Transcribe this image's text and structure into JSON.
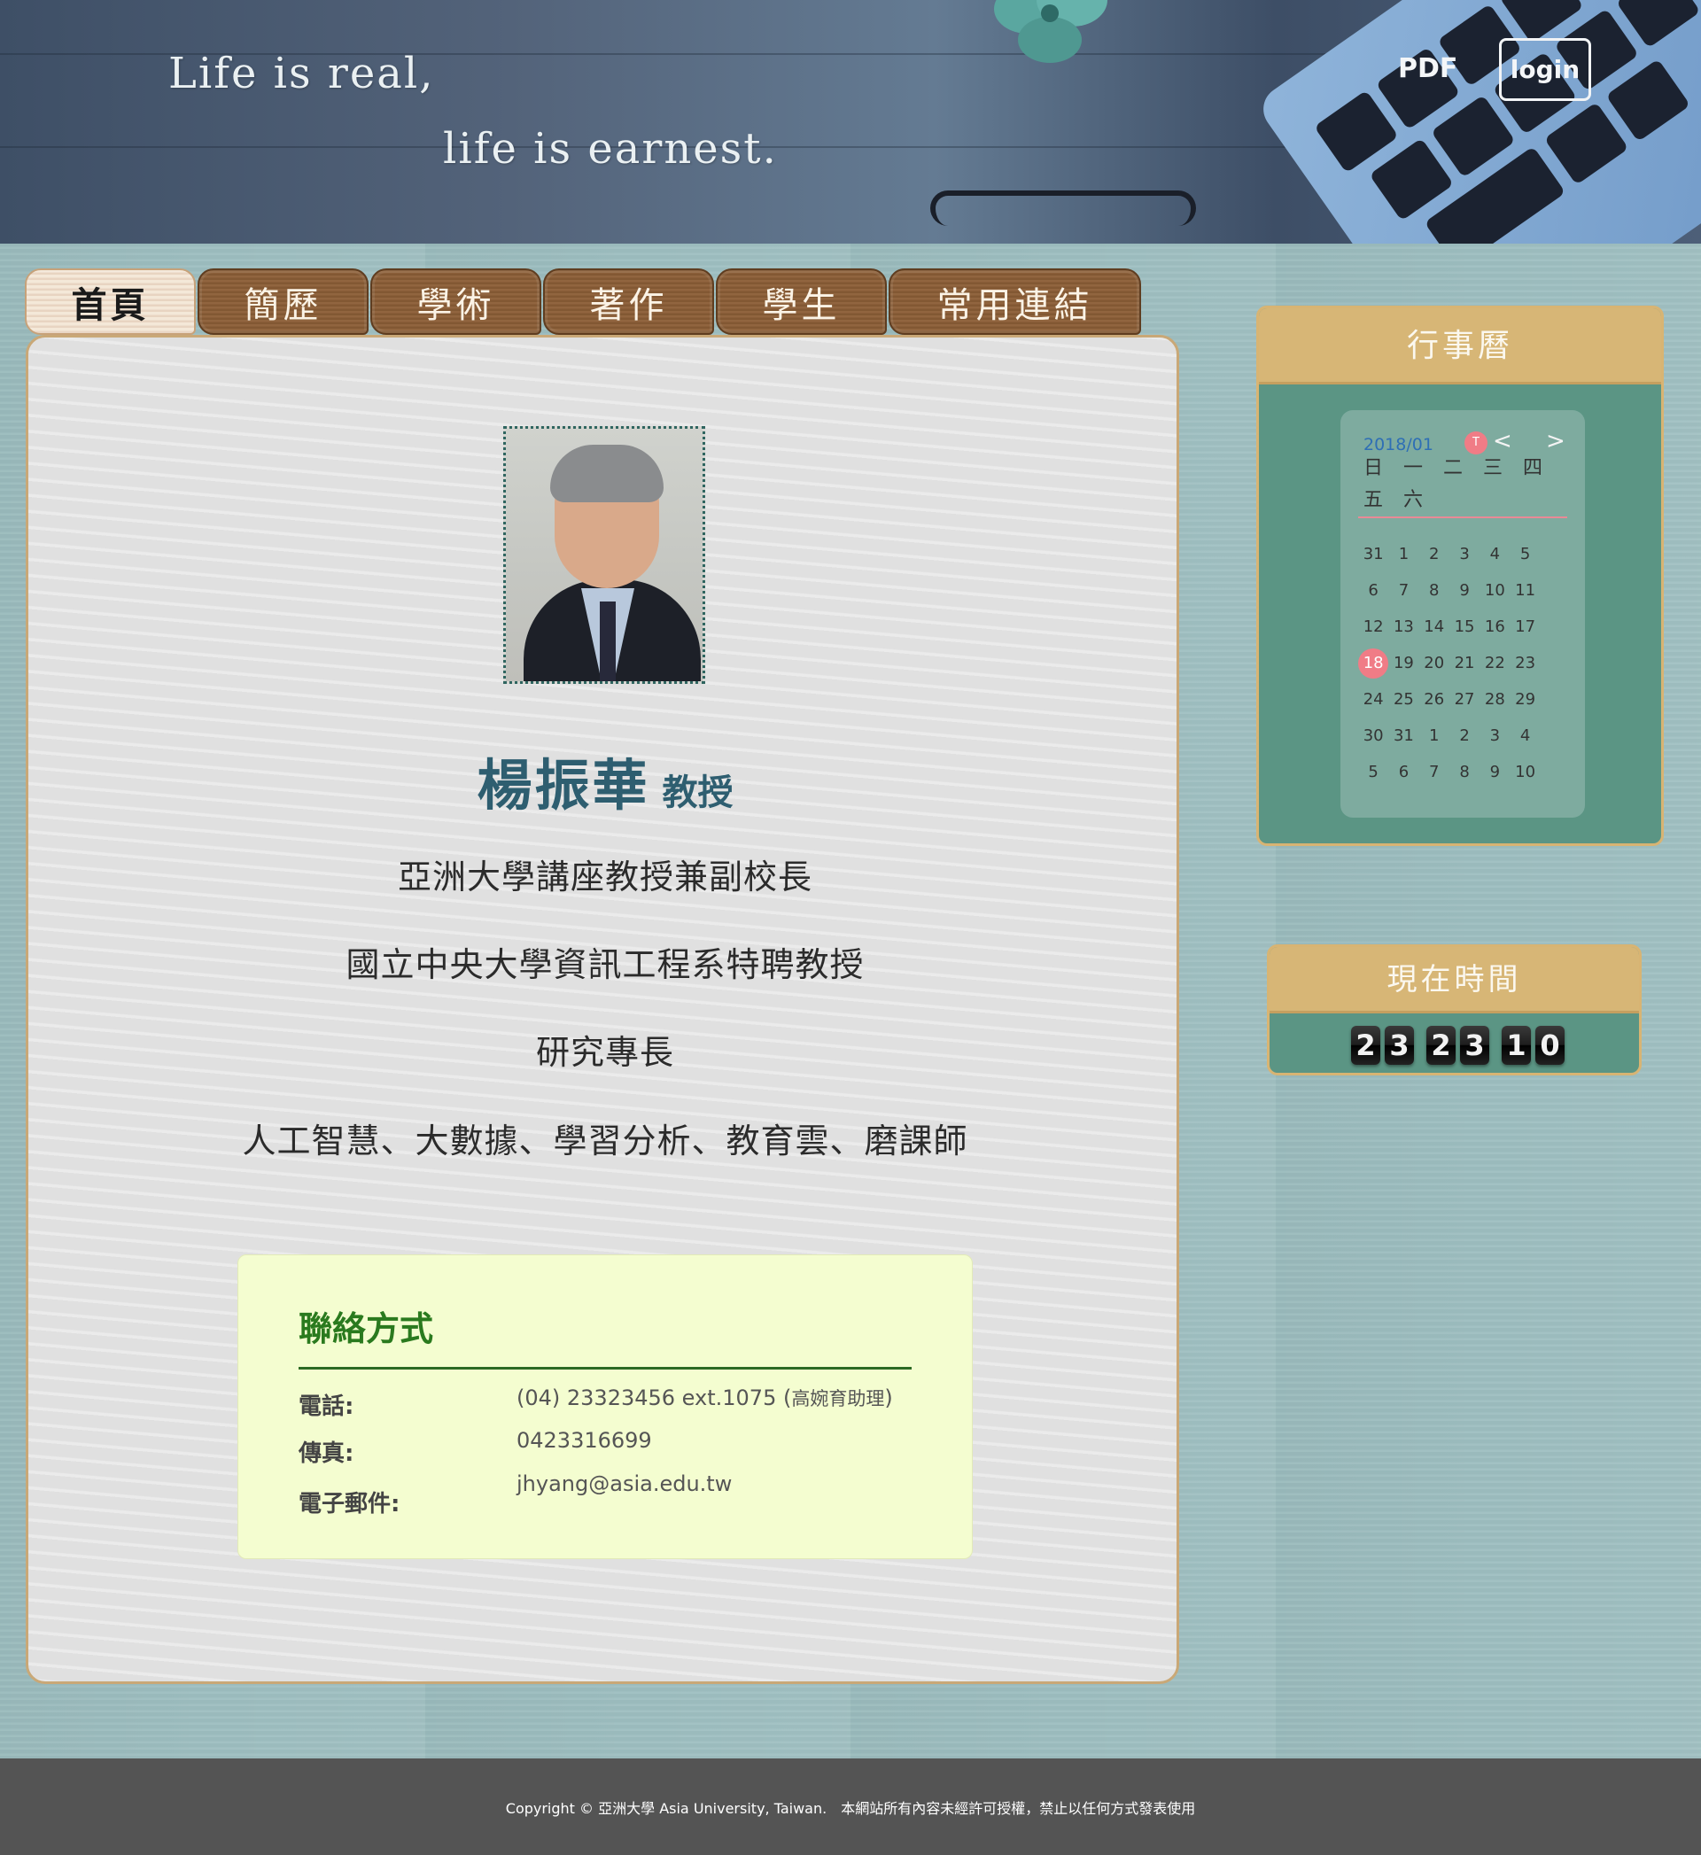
{
  "header": {
    "motto_line1": "Life is real,",
    "motto_line2": "life is earnest.",
    "pdf_label": "PDF",
    "login_label": "login"
  },
  "tabs": [
    {
      "label": "首頁",
      "active": true
    },
    {
      "label": "簡歷"
    },
    {
      "label": "學術"
    },
    {
      "label": "著作"
    },
    {
      "label": "學生"
    },
    {
      "label": "常用連結"
    }
  ],
  "profile": {
    "name": "楊振華",
    "title": "教授",
    "position1": "亞洲大學講座教授兼副校長",
    "position2": "國立中央大學資訊工程系特聘教授",
    "expertise_heading": "研究專長",
    "expertise": "人工智慧、大數據、學習分析、教育雲、磨課師"
  },
  "contact": {
    "heading": "聯絡方式",
    "phone_label": "電話:",
    "phone_value": "(04) 23323456 ext.1075 (",
    "phone_assistant": "高婉育助理",
    "phone_close": ")",
    "fax_label": "傳真:",
    "fax_value": "0423316699",
    "email_label": "電子郵件:",
    "email_value": "jhyang@asia.edu.tw"
  },
  "calendar": {
    "heading": "行事曆",
    "month": "2018/01",
    "today_marker": "T",
    "prev": "<",
    "next": ">",
    "weekdays": "日 一 二 三 四 五 六",
    "today": "18",
    "weeks": [
      [
        "31",
        "1",
        "2",
        "3",
        "4",
        "5"
      ],
      [
        "6",
        "7",
        "8",
        "9",
        "10",
        "11"
      ],
      [
        "12",
        "13",
        "14",
        "15",
        "16",
        "17"
      ],
      [
        "18",
        "19",
        "20",
        "21",
        "22",
        "23"
      ],
      [
        "24",
        "25",
        "26",
        "27",
        "28",
        "29"
      ],
      [
        "30",
        "31",
        "1",
        "2",
        "3",
        "4"
      ],
      [
        "5",
        "6",
        "7",
        "8",
        "9",
        "10"
      ]
    ]
  },
  "clock": {
    "heading": "現在時間",
    "digits": [
      "2",
      "3",
      "2",
      "3",
      "1",
      "0"
    ]
  },
  "footer": {
    "copyright": "Copyright © 亞洲大學 Asia University, Taiwan.",
    "notice": "本網站所有內容未經許可授權，禁止以任何方式發表使用"
  },
  "colors": {
    "accent_tab": "#8d5f37",
    "widget_body": "#5b9584",
    "widget_header": "#d7b676",
    "name_color": "#2e5e70",
    "contact_heading": "#2a7a1e",
    "contact_bg": "#f4fdd0",
    "today_highlight": "#f07c86"
  }
}
